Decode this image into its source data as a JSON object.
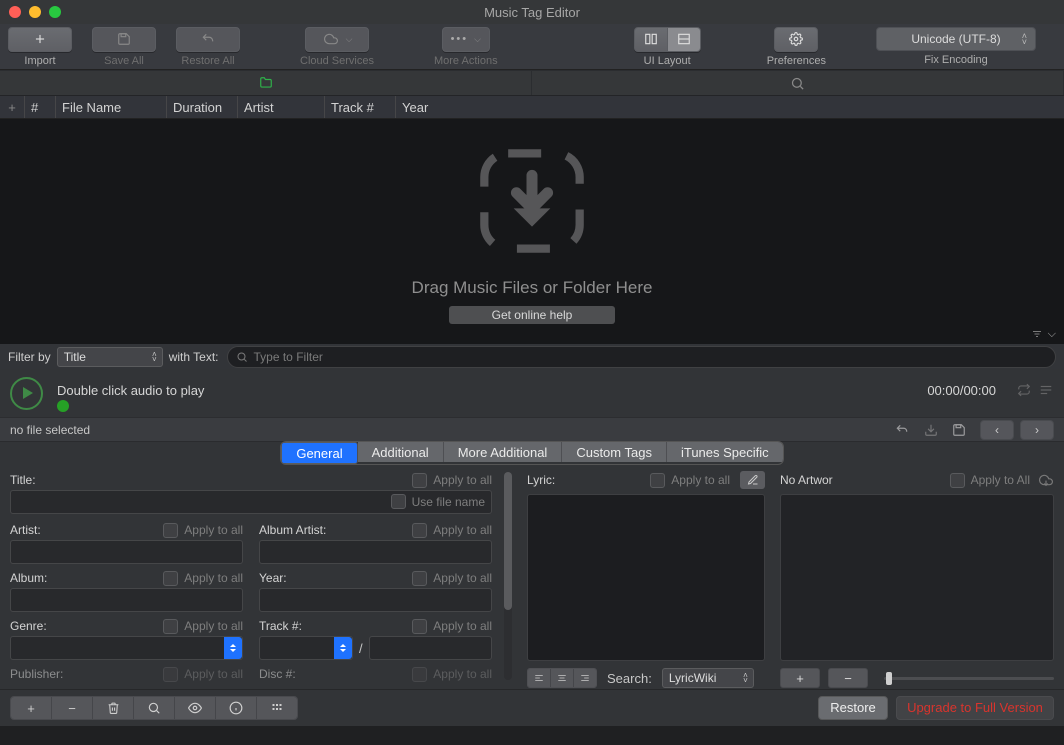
{
  "window": {
    "title": "Music Tag Editor"
  },
  "toolbar": {
    "import": "Import",
    "save_all": "Save All",
    "restore_all": "Restore All",
    "cloud_services": "Cloud Services",
    "more_actions": "More Actions",
    "ui_layout": "UI Layout",
    "preferences": "Preferences",
    "fix_encoding": "Fix Encoding",
    "encoding_value": "Unicode (UTF-8)"
  },
  "columns": {
    "num": "#",
    "filename": "File Name",
    "duration": "Duration",
    "artist": "Artist",
    "track": "Track #",
    "year": "Year"
  },
  "drop": {
    "text": "Drag Music Files or Folder Here",
    "help": "Get online help"
  },
  "filter": {
    "label": "Filter by",
    "field": "Title",
    "with_text": "with Text:",
    "placeholder": "Type to Filter"
  },
  "player": {
    "hint": "Double click audio to play",
    "time": "00:00/00:00"
  },
  "status": {
    "no_file": "no file selected"
  },
  "tabs": [
    "General",
    "Additional",
    "More Additional",
    "Custom Tags",
    "iTunes Specific"
  ],
  "form": {
    "title": "Title:",
    "use_file_name": "Use file name",
    "artist": "Artist:",
    "album_artist": "Album Artist:",
    "album": "Album:",
    "year": "Year:",
    "genre": "Genre:",
    "track": "Track #:",
    "track_sep": "/",
    "publisher": "Publisher:",
    "disc": "Disc #:",
    "apply_all": "Apply to all"
  },
  "lyric": {
    "label": "Lyric:",
    "apply_all": "Apply to all",
    "search": "Search:",
    "source": "LyricWiki"
  },
  "artwork": {
    "label": "No Artwor",
    "apply_all": "Apply to All"
  },
  "bottom": {
    "restore": "Restore",
    "upgrade": "Upgrade to Full Version"
  }
}
